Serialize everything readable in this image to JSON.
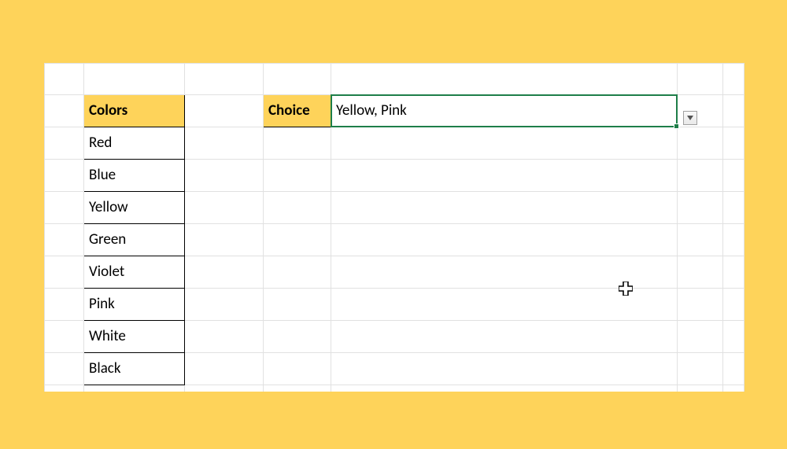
{
  "headers": {
    "colors": "Colors",
    "choice": "Choice"
  },
  "colors_list": [
    "Red",
    "Blue",
    "Yellow",
    "Green",
    "Violet",
    "Pink",
    "White",
    "Black"
  ],
  "choice_value": "Yellow, Pink",
  "colors_used": {
    "highlight_bg": "#fed35a",
    "selection_border": "#1e7e49",
    "grid_line": "#e1e1e1"
  }
}
